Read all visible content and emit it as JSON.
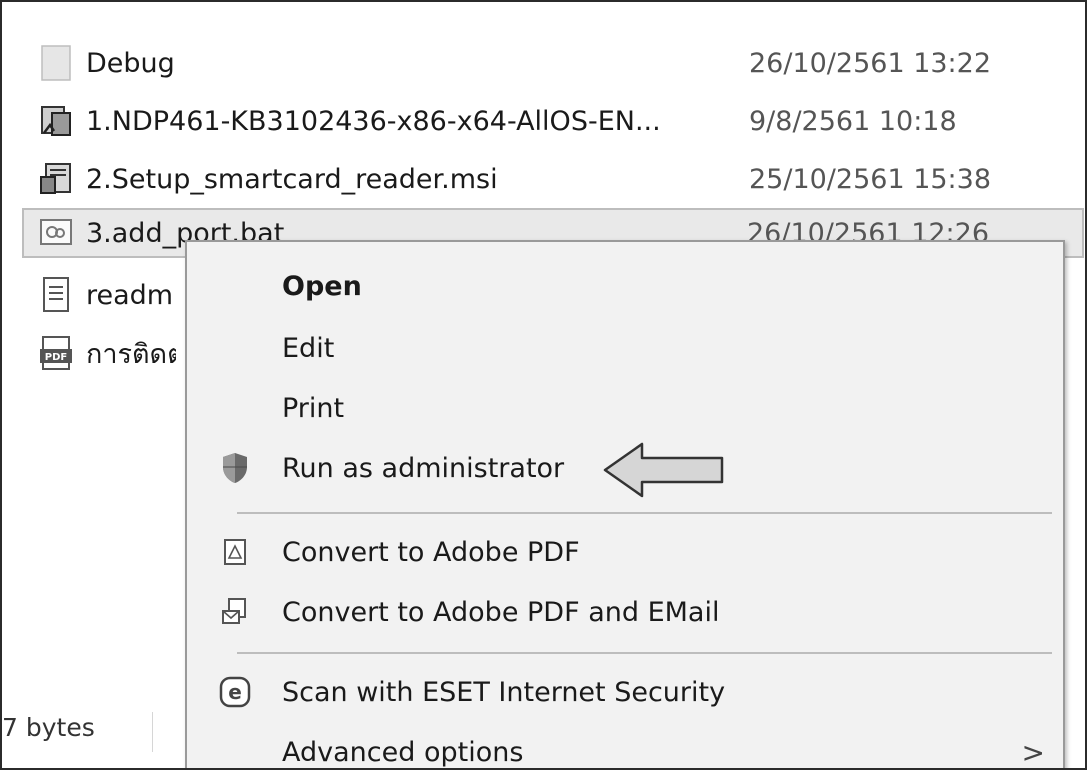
{
  "files": [
    {
      "name": "Debug",
      "date": "26/10/2561 13:22",
      "icon": "folder-icon"
    },
    {
      "name": "1.NDP461-KB3102436-x86-x64-AllOS-EN...",
      "date": "9/8/2561 10:18",
      "icon": "installer-icon"
    },
    {
      "name": "2.Setup_smartcard_reader.msi",
      "date": "25/10/2561 15:38",
      "icon": "msi-installer-icon"
    },
    {
      "name": "3.add_port.bat",
      "date": "26/10/2561 12:26",
      "icon": "batch-file-icon"
    },
    {
      "name": "readm",
      "date": "",
      "icon": "text-file-icon"
    },
    {
      "name": "การติดต",
      "date": "",
      "icon": "pdf-file-icon"
    }
  ],
  "status_bar": {
    "size_text": "7 bytes"
  },
  "context_menu": {
    "items": [
      {
        "label": "Open",
        "icon": ""
      },
      {
        "label": "Edit",
        "icon": ""
      },
      {
        "label": "Print",
        "icon": ""
      },
      {
        "label": "Run as administrator",
        "icon": "shield-icon"
      },
      {
        "label": "Convert to Adobe PDF",
        "icon": "adobe-pdf-icon"
      },
      {
        "label": "Convert to Adobe PDF and EMail",
        "icon": "adobe-pdf-email-icon"
      },
      {
        "label": "Scan with ESET Internet Security",
        "icon": "eset-icon"
      },
      {
        "label": "Advanced options",
        "icon": "",
        "submenu": ">"
      }
    ]
  },
  "colors": {
    "menu_bg": "#f2f2f2",
    "selection_bg": "#e9e9e9",
    "text": "#1a1a1a"
  }
}
